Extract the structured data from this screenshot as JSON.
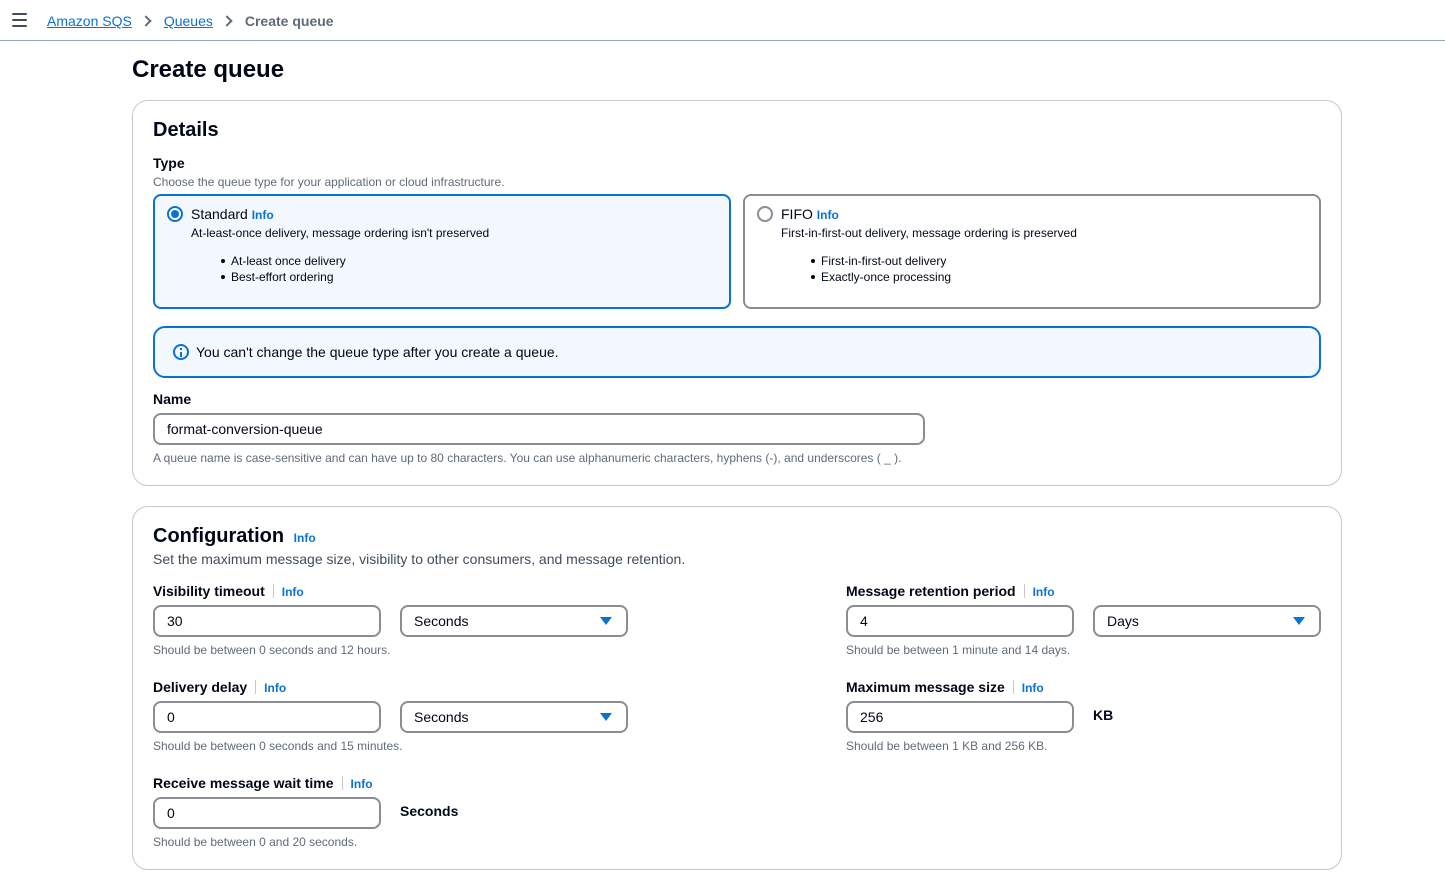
{
  "breadcrumb": {
    "items": [
      "Amazon SQS",
      "Queues"
    ],
    "current": "Create queue"
  },
  "page_title": "Create queue",
  "details": {
    "heading": "Details",
    "type_label": "Type",
    "type_description": "Choose the queue type for your application or cloud infrastructure.",
    "standard": {
      "title": "Standard",
      "info": "Info",
      "subtitle": "At-least-once delivery, message ordering isn't preserved",
      "bullets": [
        "At-least once delivery",
        "Best-effort ordering"
      ],
      "selected": true
    },
    "fifo": {
      "title": "FIFO",
      "info": "Info",
      "subtitle": "First-in-first-out delivery, message ordering is preserved",
      "bullets": [
        "First-in-first-out delivery",
        "Exactly-once processing"
      ],
      "selected": false
    },
    "alert_text": "You can't change the queue type after you create a queue.",
    "name_label": "Name",
    "name_value": "format-conversion-queue",
    "name_hint": "A queue name is case-sensitive and can have up to 80 characters. You can use alphanumeric characters, hyphens (-), and underscores ( _ )."
  },
  "configuration": {
    "heading": "Configuration",
    "info": "Info",
    "description": "Set the maximum message size, visibility to other consumers, and message retention.",
    "visibility_timeout": {
      "label": "Visibility timeout",
      "info": "Info",
      "value": "30",
      "unit": "Seconds",
      "hint": "Should be between 0 seconds and 12 hours."
    },
    "retention_period": {
      "label": "Message retention period",
      "info": "Info",
      "value": "4",
      "unit": "Days",
      "hint": "Should be between 1 minute and 14 days."
    },
    "delivery_delay": {
      "label": "Delivery delay",
      "info": "Info",
      "value": "0",
      "unit": "Seconds",
      "hint": "Should be between 0 seconds and 15 minutes."
    },
    "max_message_size": {
      "label": "Maximum message size",
      "info": "Info",
      "value": "256",
      "unit": "KB",
      "hint": "Should be between 1 KB and 256 KB."
    },
    "receive_wait_time": {
      "label": "Receive message wait time",
      "info": "Info",
      "value": "0",
      "unit": "Seconds",
      "hint": "Should be between 0 and 20 seconds."
    }
  },
  "colors": {
    "accent": "#0972d3",
    "selected_bg": "#f2f8fd",
    "text": "#000716",
    "muted": "#5f6b7a"
  },
  "icons": [
    "hamburger-menu-icon",
    "chevron-right-icon",
    "info-circle-icon",
    "caret-down-icon"
  ]
}
